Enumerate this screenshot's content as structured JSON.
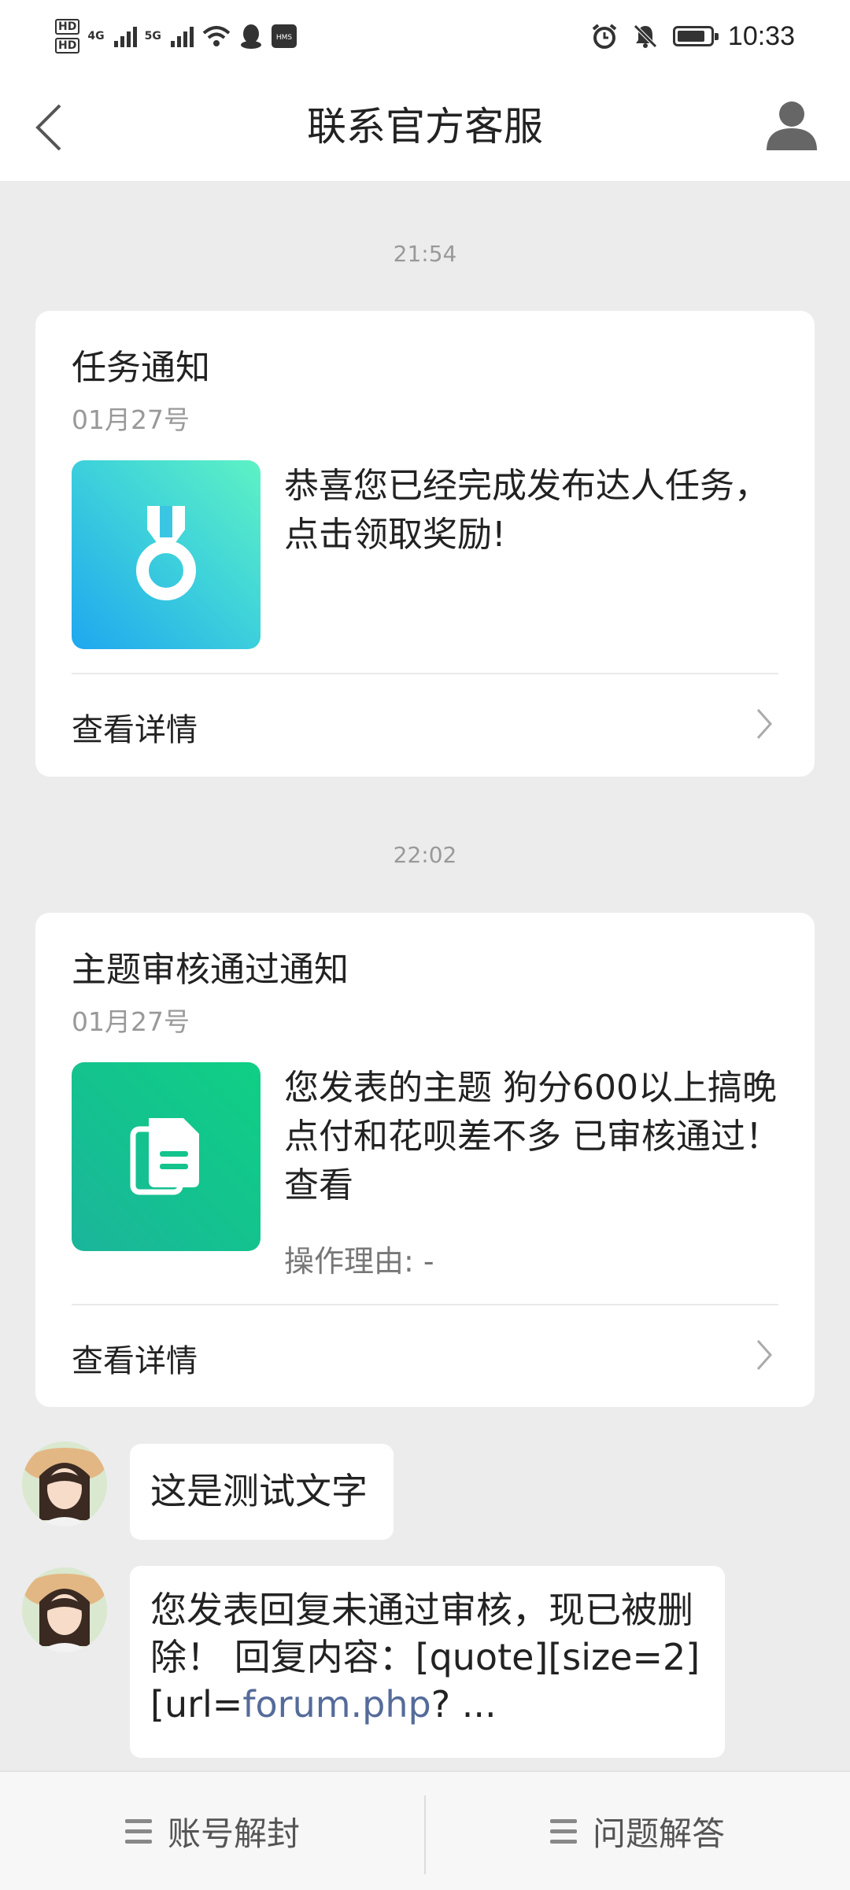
{
  "status_bar": {
    "hd1": "HD",
    "hd2": "HD",
    "net1": "4G",
    "net2": "5G",
    "time": "10:33",
    "icons": [
      "signal-icon",
      "signal-icon",
      "wifi-icon",
      "qq-icon",
      "hms-icon",
      "alarm-icon",
      "mute-icon",
      "battery-icon"
    ]
  },
  "header": {
    "title": "联系官方客服",
    "back_icon": "chevron-left-icon",
    "profile_icon": "person-icon"
  },
  "messages": [
    {
      "time": "21:54",
      "title": "任务通知",
      "date": "01月27号",
      "thumb_icon": "medal-icon",
      "body": "恭喜您已经完成发布达人任务，点击领取奖励!",
      "reason": "",
      "link": "查看详情"
    },
    {
      "time": "22:02",
      "title": "主题审核通过通知",
      "date": "01月27号",
      "thumb_icon": "document-icon",
      "body": "您发表的主题 狗分600以上搞晚点付和花呗差不多 已审核通过！ 查看",
      "reason": "操作理由: -",
      "link": "查看详情"
    }
  ],
  "chat": [
    {
      "text": "这是测试文字"
    },
    {
      "text_pre": "您发表回复未通过审核，现已被删除！ 回复内容：[quote][size=2][url=",
      "link_text": "forum.php",
      "text_post": "? ..."
    }
  ],
  "bottom_tabs": [
    {
      "label": "账号解封",
      "icon": "menu-icon"
    },
    {
      "label": "问题解答",
      "icon": "menu-icon"
    }
  ],
  "colors": {
    "background": "#ececec",
    "card": "#ffffff",
    "thumb_blue_start": "#1fa7f0",
    "thumb_blue_end": "#5ef2c4",
    "thumb_green_start": "#1bb59c",
    "thumb_green_end": "#10cf85",
    "link": "#556b9a"
  }
}
